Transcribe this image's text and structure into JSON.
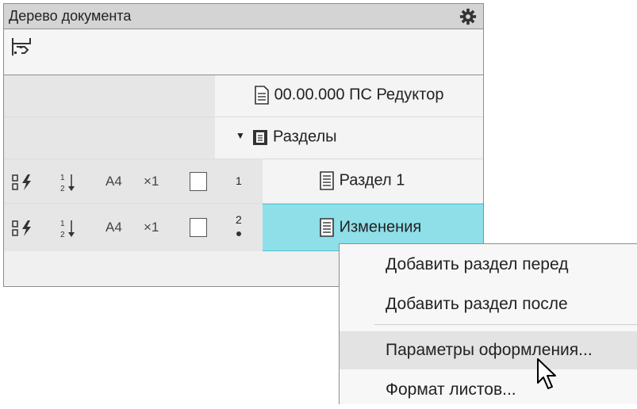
{
  "panel": {
    "title": "Дерево документа",
    "gear_icon": "gear-icon",
    "toolbar_icon": "tree-structure-icon"
  },
  "rows": [
    {
      "label": "00.00.000 ПС Редуктор",
      "icon": "document-icon"
    },
    {
      "label": "Разделы",
      "icon": "folder-document-icon",
      "expanded": true
    },
    {
      "label": "Раздел 1",
      "format": "A4",
      "mult": "×1",
      "num": "1",
      "icon": "document-icon"
    },
    {
      "label": "Изменения",
      "format": "A4",
      "mult": "×1",
      "num": "2",
      "icon": "document-icon",
      "selected": true
    }
  ],
  "context_menu": {
    "items": [
      "Добавить раздел перед",
      "Добавить раздел после",
      "Параметры оформления...",
      "Формат листов..."
    ],
    "hovered_index": 2
  },
  "colors": {
    "selection": "#8fdfe9",
    "selection_border": "#4ec3d6",
    "title_bg": "#d4d4d4"
  }
}
